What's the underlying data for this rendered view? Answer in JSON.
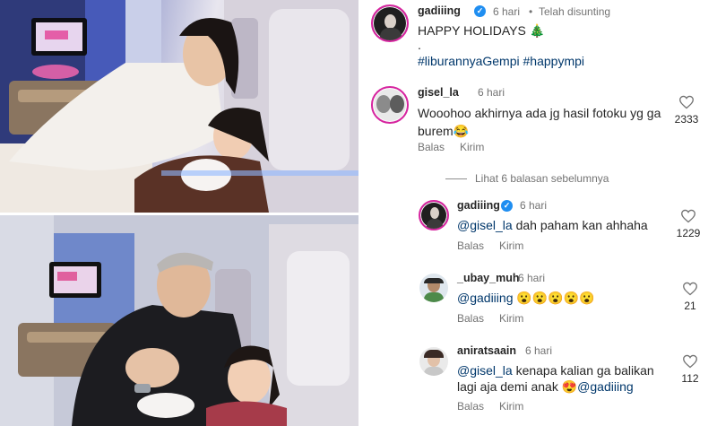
{
  "post": {
    "username": "gadiiing",
    "time": "6 hari",
    "edited": "Telah disunting",
    "separator": "•",
    "caption_line1": "HAPPY HOLIDAYS",
    "caption_emoji": "🎄",
    "caption_line2": ".",
    "hashtags": "#liburannyaGempi #happympi"
  },
  "comments": [
    {
      "username": "gisel_la",
      "time": "6 hari",
      "text": "Wooohoo akhirnya ada jg hasil fotoku yg ga burem😂",
      "reply_label": "Balas",
      "send_label": "Kirim",
      "likes": "2333"
    }
  ],
  "view_replies": "Lihat 6 balasan sebelumnya",
  "replies": [
    {
      "username": "gadiiing",
      "time": "6 hari",
      "mention": "@gisel_la",
      "text": " dah paham kan ahhaha",
      "reply_label": "Balas",
      "send_label": "Kirim",
      "likes": "1229"
    },
    {
      "username": "_ubay_muh",
      "time": "6 hari",
      "mention": "@gadiiing",
      "text": " 😮😮😮😮😮",
      "reply_label": "Balas",
      "send_label": "Kirim",
      "likes": "21"
    },
    {
      "username": "aniratsaain",
      "time": "6 hari",
      "mention": "@gisel_la",
      "text_line1": " kenapa kalian ga balikan",
      "text_line2": "lagi aja demi anak 😍",
      "mention2": "@gadiiing",
      "reply_label": "Balas",
      "send_label": "Kirim",
      "likes": "112"
    }
  ],
  "icons": {
    "verified": "verified-badge-icon",
    "like": "heart-icon"
  },
  "colors": {
    "link": "#00376b",
    "verified": "#1f8ef1",
    "story_ring": "#d6249f",
    "muted": "#737373"
  }
}
